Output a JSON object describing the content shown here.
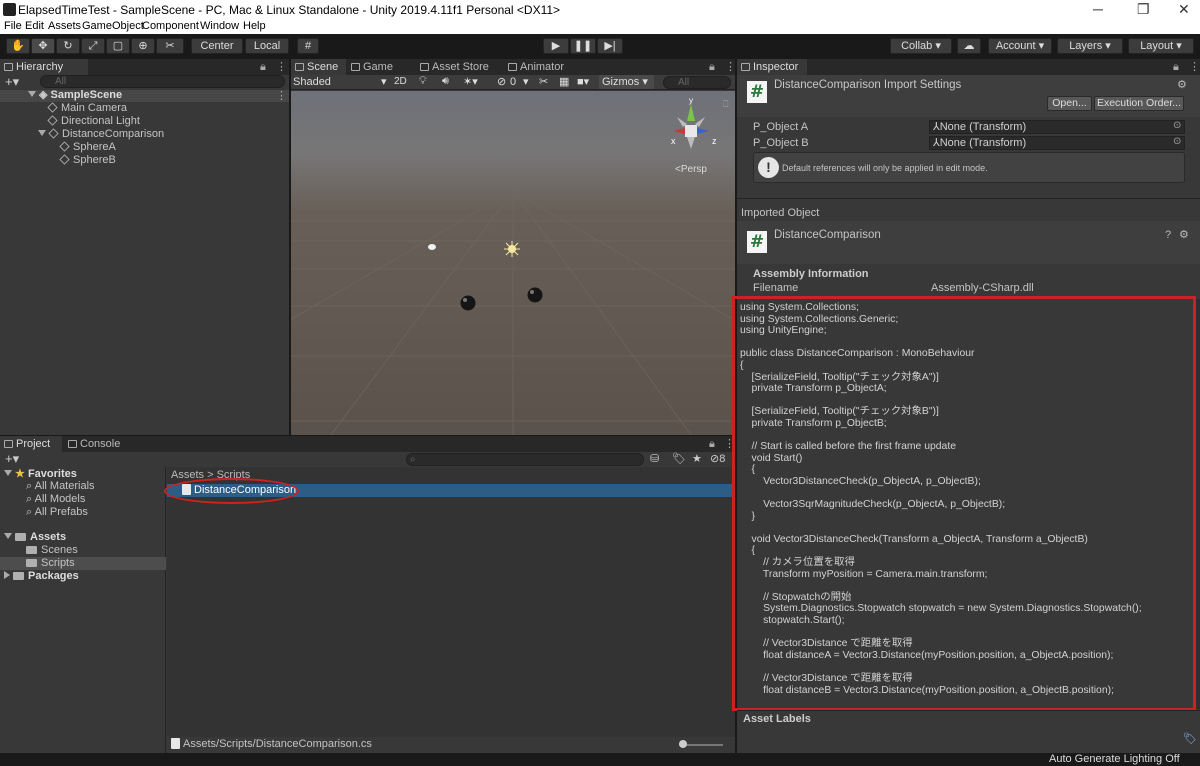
{
  "window": {
    "title": "ElapsedTimeTest - SampleScene - PC, Mac & Linux Standalone - Unity 2019.4.11f1 Personal <DX11>",
    "minimize": "─",
    "restore": "❐",
    "close": "✕"
  },
  "menu": [
    "File",
    "Edit",
    "Assets",
    "GameObject",
    "Component",
    "Window",
    "Help"
  ],
  "toolbar": {
    "center": "Center",
    "local": "Local",
    "collab": "Collab ▾",
    "account": "Account",
    "layers": "Layers",
    "layout": "Layout"
  },
  "hierarchy": {
    "tab": "Hierarchy",
    "search_placeholder": "All",
    "scene": "SampleScene",
    "items": [
      "Main Camera",
      "Directional Light",
      "DistanceComparison",
      "SphereA",
      "SphereB"
    ]
  },
  "scene_view": {
    "tabs": [
      "Scene",
      "Game",
      "Asset Store",
      "Animator"
    ],
    "shading": "Shaded",
    "mode_2d": "2D",
    "hidden_count": "0",
    "gizmos": "Gizmos",
    "search_placeholder": "All",
    "persp": "<Persp",
    "axes": {
      "x": "x",
      "z": "z",
      "y": "y"
    }
  },
  "project": {
    "tabs": [
      "Project",
      "Console"
    ],
    "favorites_label": "Favorites",
    "favorites": [
      "All Materials",
      "All Models",
      "All Prefabs"
    ],
    "assets_label": "Assets",
    "asset_folders": [
      "Scenes",
      "Scripts"
    ],
    "packages_label": "Packages",
    "breadcrumb": [
      "Assets",
      ">",
      "Scripts"
    ],
    "selected_file": "DistanceComparison",
    "status_path": "Assets/Scripts/DistanceComparison.cs",
    "hidden_count": "8"
  },
  "inspector": {
    "tab": "Inspector",
    "title": "DistanceComparison Import Settings",
    "open_button": "Open...",
    "exec_order_button": "Execution Order...",
    "fields": [
      {
        "label": "P_Object A",
        "value": "None (Transform)"
      },
      {
        "label": "P_Object B",
        "value": "None (Transform)"
      }
    ],
    "note": "Default references will only be applied in edit mode.",
    "imported_object_label": "Imported Object",
    "imported_name": "DistanceComparison",
    "assembly_info_label": "Assembly Information",
    "filename_label": "Filename",
    "filename_value": "Assembly-CSharp.dll",
    "asset_labels": "Asset Labels",
    "code": [
      "using System.Collections;",
      "using System.Collections.Generic;",
      "using UnityEngine;",
      "",
      "public class DistanceComparison : MonoBehaviour",
      "{",
      "    [SerializeField, Tooltip(\"チェック対象A\")]",
      "    private Transform p_ObjectA;",
      "",
      "    [SerializeField, Tooltip(\"チェック対象B\")]",
      "    private Transform p_ObjectB;",
      "",
      "    // Start is called before the first frame update",
      "    void Start()",
      "    {",
      "        Vector3DistanceCheck(p_ObjectA, p_ObjectB);",
      "",
      "        Vector3SqrMagnitudeCheck(p_ObjectA, p_ObjectB);",
      "    }",
      "",
      "    void Vector3DistanceCheck(Transform a_ObjectA, Transform a_ObjectB)",
      "    {",
      "        // カメラ位置を取得",
      "        Transform myPosition = Camera.main.transform;",
      "",
      "        // Stopwatchの開始",
      "        System.Diagnostics.Stopwatch stopwatch = new System.Diagnostics.Stopwatch();",
      "        stopwatch.Start();",
      "",
      "        // Vector3Distance で距離を取得",
      "        float distanceA = Vector3.Distance(myPosition.position, a_ObjectA.position);",
      "",
      "        // Vector3Distance で距離を取得",
      "        float distanceB = Vector3.Distance(myPosition.position, a_ObjectB.position);"
    ]
  },
  "statusbar": {
    "text": "Auto Generate Lighting Off"
  },
  "colors": {
    "highlight": "#cc2222",
    "selection": "#2c5d87"
  }
}
